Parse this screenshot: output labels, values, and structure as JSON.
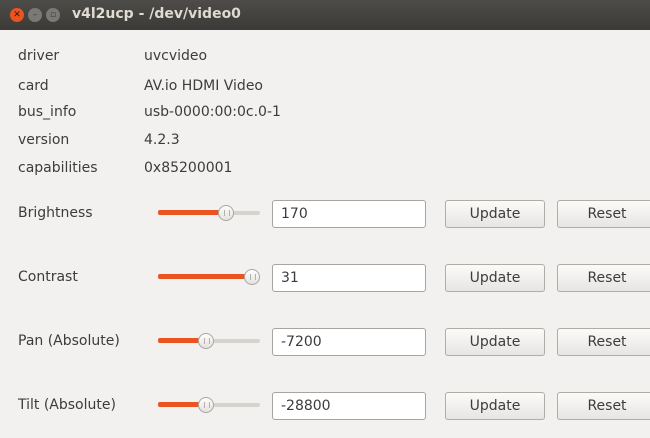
{
  "window": {
    "title": "v4l2ucp - /dev/video0",
    "close_glyph": "✕",
    "min_glyph": "–",
    "max_glyph": "▫"
  },
  "info": [
    {
      "label": "driver",
      "value": "uvcvideo"
    },
    {
      "label": "card",
      "value": "AV.io HDMI Video"
    },
    {
      "label": "bus_info",
      "value": "usb-0000:00:0c.0-1"
    },
    {
      "label": "version",
      "value": "4.2.3"
    },
    {
      "label": "capabilities",
      "value": "0x85200001"
    }
  ],
  "controls": [
    {
      "label": "Brightness",
      "value": "170",
      "slider_fraction": 0.67
    },
    {
      "label": "Contrast",
      "value": "31",
      "slider_fraction": 0.92
    },
    {
      "label": "Pan (Absolute)",
      "value": "-7200",
      "slider_fraction": 0.47
    },
    {
      "label": "Tilt (Absolute)",
      "value": "-28800",
      "slider_fraction": 0.47
    }
  ],
  "buttons": {
    "update_label": "Update",
    "reset_label": "Reset"
  },
  "colors": {
    "accent": "#e95420",
    "titlebar": "#3c3b37",
    "background": "#f2f1f0"
  }
}
